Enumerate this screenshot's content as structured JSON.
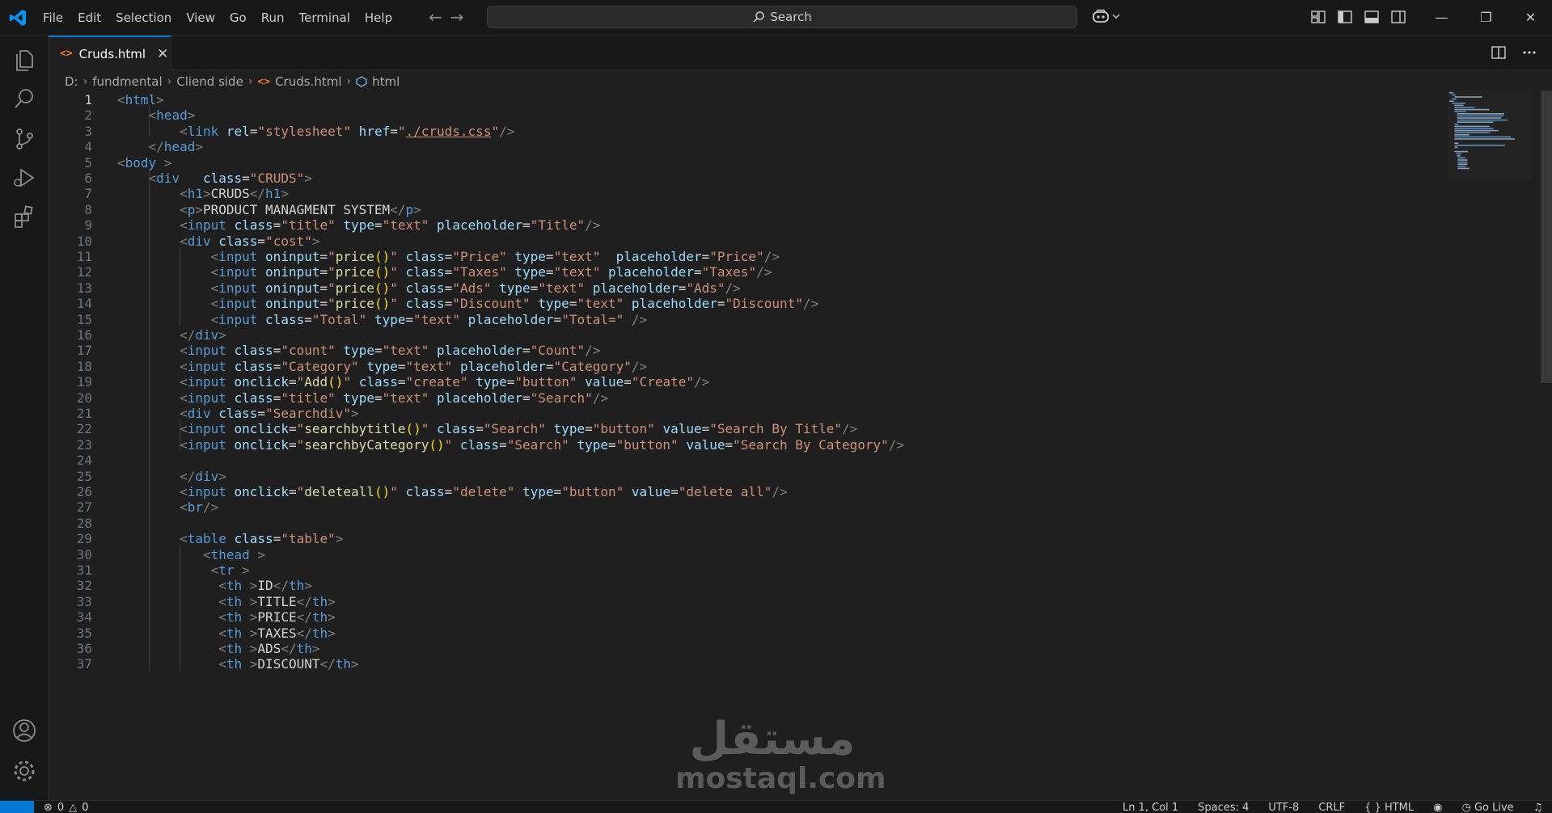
{
  "titlebar": {
    "menu": [
      "File",
      "Edit",
      "Selection",
      "View",
      "Go",
      "Run",
      "Terminal",
      "Help"
    ],
    "search_label": "Search"
  },
  "tab": {
    "label": "Cruds.html",
    "icon": "html-file-icon"
  },
  "breadcrumb": {
    "items": [
      "D:",
      "fundmental",
      "Cliend side",
      "Cruds.html",
      "html"
    ]
  },
  "editor": {
    "active_line": 1,
    "lines": [
      "<html>",
      "    <head>",
      "        <link rel=\"stylesheet\" href=\"./cruds.css\"/>",
      "    </head>",
      "<body >",
      "    <div   class=\"CRUDS\">",
      "        <h1>CRUDS</h1>",
      "        <p>PRODUCT MANAGMENT SYSTEM</p>",
      "        <input class=\"title\" type=\"text\" placeholder=\"Title\"/>",
      "        <div class=\"cost\">",
      "            <input oninput=\"price()\" class=\"Price\" type=\"text\"  placeholder=\"Price\"/>",
      "            <input oninput=\"price()\" class=\"Taxes\" type=\"text\" placeholder=\"Taxes\"/>",
      "            <input oninput=\"price()\" class=\"Ads\" type=\"text\" placeholder=\"Ads\"/>",
      "            <input oninput=\"price()\" class=\"Discount\" type=\"text\" placeholder=\"Discount\"/>",
      "            <input class=\"Total\" type=\"text\" placeholder=\"Total=\" />",
      "        </div>",
      "        <input class=\"count\" type=\"text\" placeholder=\"Count\"/>",
      "        <input class=\"Category\" type=\"text\" placeholder=\"Category\"/>",
      "        <input onclick=\"Add()\" class=\"create\" type=\"button\" value=\"Create\"/>",
      "        <input class=\"title\" type=\"text\" placeholder=\"Search\"/>",
      "        <div class=\"Searchdiv\">",
      "        <input onclick=\"searchbytitle()\" class=\"Search\" type=\"button\" value=\"Search By Title\"/>",
      "        <input onclick=\"searchbyCategory()\" class=\"Search\" type=\"button\" value=\"Search By Category\"/>",
      "",
      "        </div>",
      "        <input onclick=\"deleteall()\" class=\"delete\" type=\"button\" value=\"delete all\"/>",
      "        <br/>",
      "",
      "        <table class=\"table\">",
      "           <thead >",
      "            <tr >",
      "             <th >ID</th>",
      "             <th >TITLE</th>",
      "             <th >PRICE</th>",
      "             <th >TAXES</th>",
      "             <th >ADS</th>",
      "             <th >DISCOUNT</th>"
    ]
  },
  "watermark": {
    "arabic": "مستقل",
    "latin": "mostaql.com"
  },
  "statusbar": {
    "problems": "0",
    "warnings": "0",
    "position": "Ln 1, Col 1",
    "spaces": "Spaces: 4",
    "encoding": "UTF-8",
    "eol": "CRLF",
    "language": "HTML",
    "golive": "Go Live"
  },
  "colors": {
    "accent": "#0078d4",
    "background": "#1f1f1f",
    "tag": "#569cd6",
    "attribute": "#9cdcfe",
    "string": "#ce9178"
  }
}
